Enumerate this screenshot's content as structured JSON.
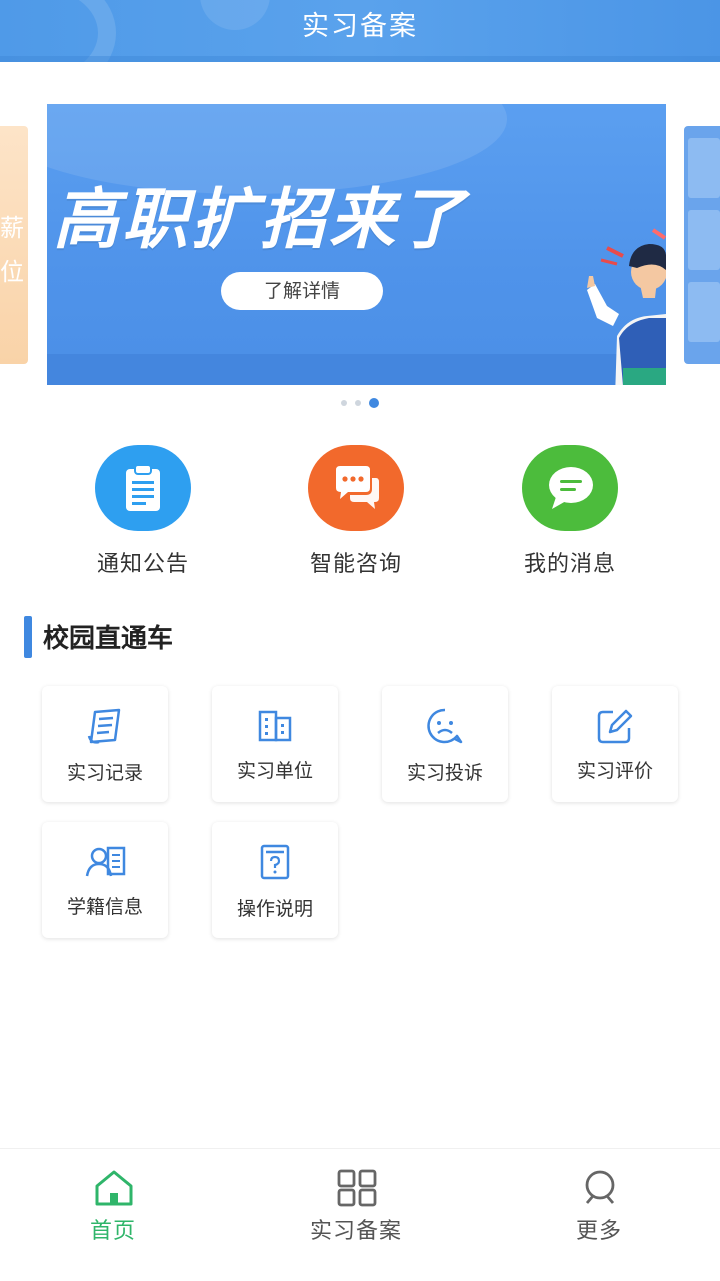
{
  "header": {
    "title": "实习备案"
  },
  "banner": {
    "headline": "高职扩招来了",
    "button_label": "了解详情",
    "side_left_text": "薪\n位",
    "pager": {
      "count": 3,
      "active_index": 2
    }
  },
  "quick_actions": [
    {
      "label": "通知公告",
      "icon": "clipboard-icon",
      "color": "#2e9ff0"
    },
    {
      "label": "智能咨询",
      "icon": "chat-bubbles-icon",
      "color": "#f2692c"
    },
    {
      "label": "我的消息",
      "icon": "message-icon",
      "color": "#4cbc3c"
    }
  ],
  "section": {
    "title": "校园直通车"
  },
  "cards": [
    {
      "label": "实习记录",
      "icon": "notebook-icon"
    },
    {
      "label": "实习单位",
      "icon": "building-icon"
    },
    {
      "label": "实习投诉",
      "icon": "sad-face-icon"
    },
    {
      "label": "实习评价",
      "icon": "edit-icon"
    },
    {
      "label": "学籍信息",
      "icon": "student-card-icon"
    },
    {
      "label": "操作说明",
      "icon": "help-document-icon"
    }
  ],
  "tabbar": {
    "tabs": [
      {
        "label": "首页",
        "icon": "home-icon",
        "active": true
      },
      {
        "label": "实习备案",
        "icon": "grid-icon",
        "active": false
      },
      {
        "label": "更多",
        "icon": "more-icon",
        "active": false
      }
    ]
  },
  "colors": {
    "primary": "#3f88e0",
    "active_tab": "#2fb56a"
  }
}
